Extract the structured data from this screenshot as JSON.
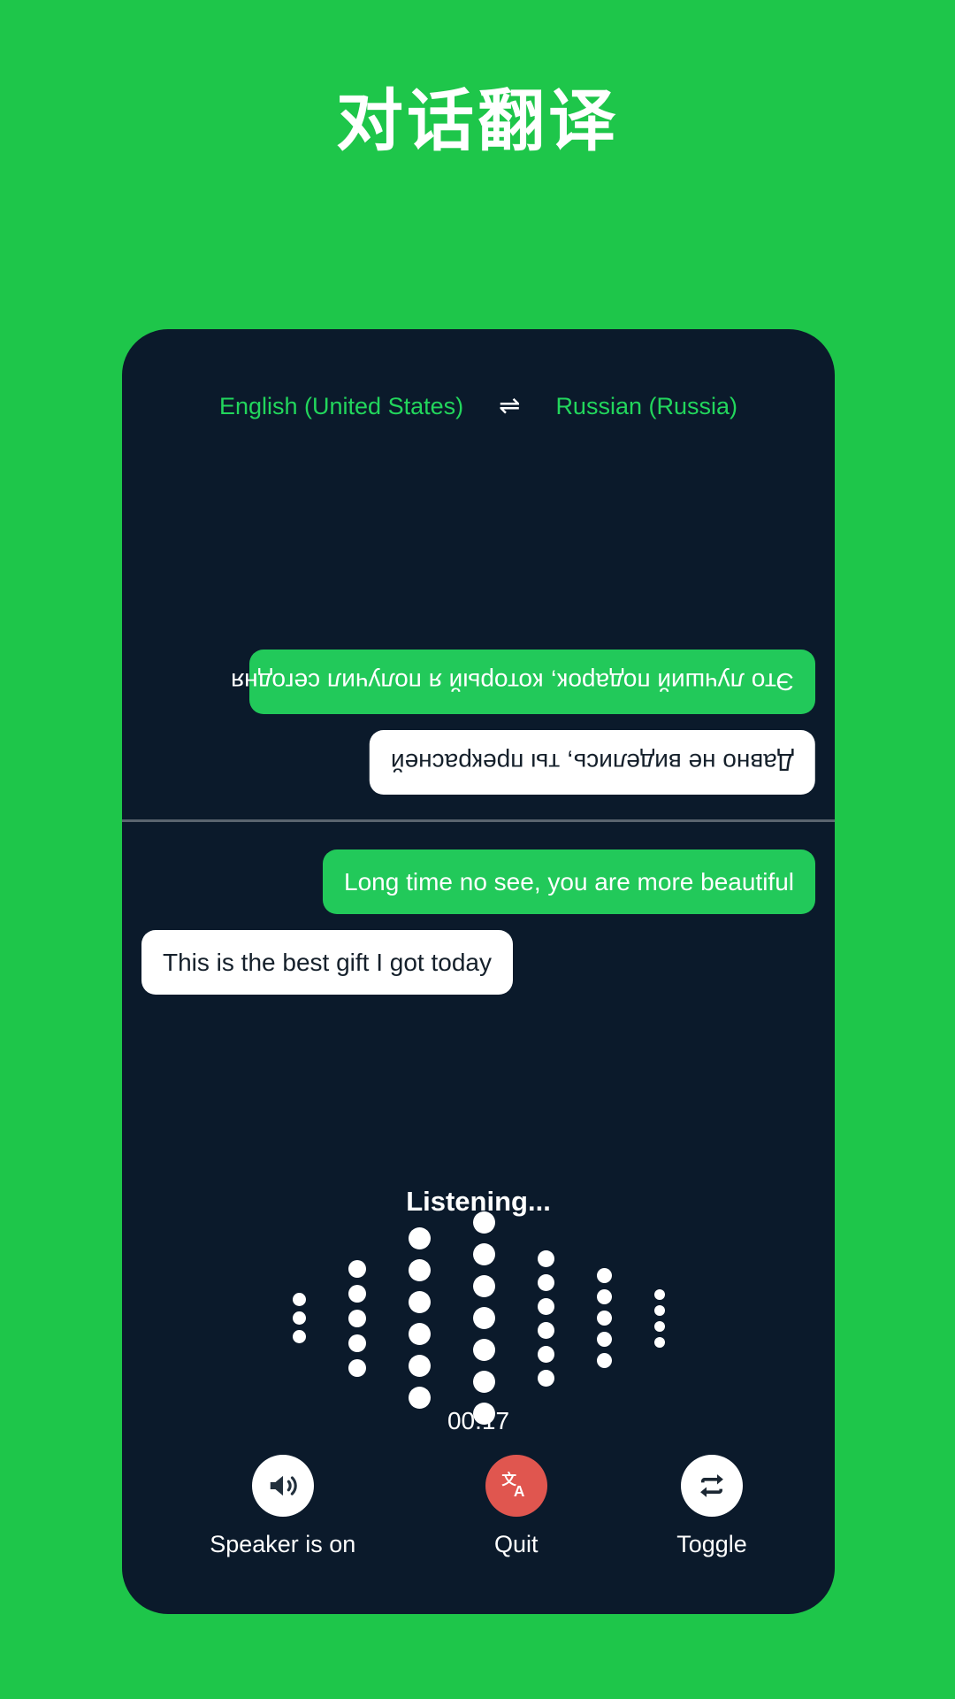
{
  "page": {
    "title": "对话翻译",
    "background_color": "#1ec64a",
    "card_color": "#0b1a2b"
  },
  "language_bar": {
    "source_language": "English (United States)",
    "swap_icon": "swap-horizontal-icon",
    "swap_glyph": "⇌",
    "target_language": "Russian (Russia)",
    "text_color": "#22d65c"
  },
  "conversation": {
    "translated_pane": {
      "rotated": true,
      "messages": [
        {
          "text": "Это лучший подарок, который я получил сегодня",
          "style": "green",
          "align": "right"
        },
        {
          "text": "Давно не виделись, ты прекрасней",
          "style": "white",
          "align": "right"
        }
      ]
    },
    "source_pane": {
      "rotated": false,
      "messages": [
        {
          "text": "Long time no see, you are more beautiful",
          "style": "green",
          "align": "right"
        },
        {
          "text": "This is the best gift I got today",
          "style": "white",
          "align": "left"
        }
      ]
    }
  },
  "status": {
    "listening_label": "Listening...",
    "timer": "00:17"
  },
  "waveform": {
    "type": "dot-matrix-audio-visualizer",
    "dot_color": "#ffffff",
    "columns": [
      {
        "dots": 3,
        "size": 15
      },
      {
        "dots": 5,
        "size": 20
      },
      {
        "dots": 6,
        "size": 25
      },
      {
        "dots": 7,
        "size": 25
      },
      {
        "dots": 6,
        "size": 19
      },
      {
        "dots": 5,
        "size": 17
      },
      {
        "dots": 4,
        "size": 12
      }
    ]
  },
  "controls": [
    {
      "label": "Speaker is on",
      "icon": "speaker-on-icon",
      "circle_color": "#ffffff",
      "icon_color": "#22303d"
    },
    {
      "label": "Quit",
      "icon": "translate-icon",
      "circle_color": "#e0564f",
      "icon_color": "#ffffff"
    },
    {
      "label": "Toggle",
      "icon": "swap-repeat-icon",
      "circle_color": "#ffffff",
      "icon_color": "#1b2733"
    }
  ]
}
